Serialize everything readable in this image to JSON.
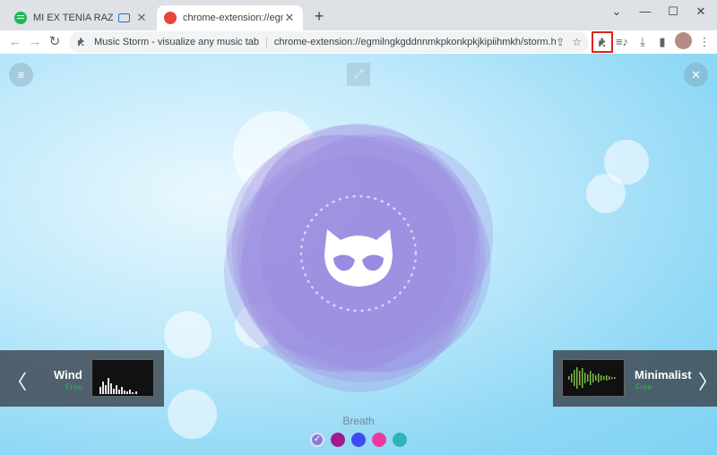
{
  "browser": {
    "tabs": [
      {
        "title": "MI EX TENÍA RAZÓN • KAROL G",
        "favicon": "spotify-icon"
      },
      {
        "title": "chrome-extension://egmilngkgddnnmkpkonkpkjkipiihmkh/storm.html",
        "favicon": "music-storm-icon"
      }
    ],
    "new_tab_label": "+",
    "window_controls": {
      "minimize": "—",
      "maximize": "☐",
      "close": "✕",
      "dropdown": "⌄"
    }
  },
  "toolbar": {
    "site_name": "Music Storm - visualize any music tab",
    "url": "chrome-extension://egmilngkgddnnmkpkonkpkjkipiihmkh/storm.html"
  },
  "visualizer": {
    "accent": "#9a8ae0",
    "presets": [
      {
        "name": "Wind",
        "price": "Free"
      },
      {
        "name": "Minimalist",
        "price": "Free"
      }
    ],
    "current_preset": "Breath",
    "colors": [
      "#8a7dd8",
      "#a31a8f",
      "#3d4cf2",
      "#ee3aa0",
      "#31b2b4"
    ]
  }
}
